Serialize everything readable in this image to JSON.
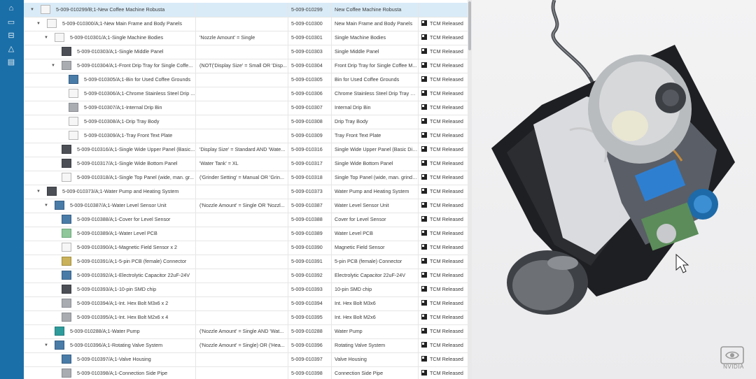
{
  "sidebar": {
    "icons": [
      "home-icon",
      "folder-icon",
      "inbox-icon",
      "warning-icon",
      "document-icon"
    ]
  },
  "rows": [
    {
      "name": "5-009-010299/B;1-New Coffee Machine Robusta",
      "effectivity": "",
      "part_number": "5-009-010299",
      "title": "New Coffee Machine Robusta",
      "status": ""
    },
    {
      "name": "5-009-010300/A;1-New Main Frame and Body Panels",
      "effectivity": "",
      "part_number": "5-009-010300",
      "title": "New Main Frame and Body Panels",
      "status": "TCM Released"
    },
    {
      "name": "5-009-010301/A;1-Single Machine Bodies",
      "effectivity": "'Nozzle Amount' = Single",
      "part_number": "5-009-010301",
      "title": "Single Machine Bodies",
      "status": "TCM Released"
    },
    {
      "name": "5-009-010303/A;1-Single Middle Panel",
      "effectivity": "",
      "part_number": "5-009-010303",
      "title": "Single Middle Panel",
      "status": "TCM Released"
    },
    {
      "name": "5-009-010304/A;1-Front Drip Tray for Single Coffe...",
      "effectivity": "(NOT('Display Size' = Small OR 'Disp...",
      "part_number": "5-009-010304",
      "title": "Front Drip Tray for Single Coffee M...",
      "status": "TCM Released"
    },
    {
      "name": "5-009-010305/A;1-Bin for Used Coffee Grounds",
      "effectivity": "",
      "part_number": "5-009-010305",
      "title": "Bin for Used Coffee Grounds",
      "status": "TCM Released"
    },
    {
      "name": "5-009-010306/A;1-Chrome Stainless Steel Drip ...",
      "effectivity": "",
      "part_number": "5-009-010306",
      "title": "Chrome Stainless Steel Drip Tray Pl...",
      "status": "TCM Released"
    },
    {
      "name": "5-009-010307/A;1-Internal Drip Bin",
      "effectivity": "",
      "part_number": "5-009-010307",
      "title": "Internal Drip Bin",
      "status": "TCM Released"
    },
    {
      "name": "5-009-010308/A;1-Drip Tray Body",
      "effectivity": "",
      "part_number": "5-009-010308",
      "title": "Drip Tray Body",
      "status": "TCM Released"
    },
    {
      "name": "5-009-010309/A;1-Tray Front Text Plate",
      "effectivity": "",
      "part_number": "5-009-010309",
      "title": "Tray Front Text Plate",
      "status": "TCM Released"
    },
    {
      "name": "5-009-010316/A;1-Single Wide Upper Panel (Basic...",
      "effectivity": "'Display Size' = Standard AND 'Wate...",
      "part_number": "5-009-010316",
      "title": "Single Wide Upper Panel (Basic Dis...",
      "status": "TCM Released"
    },
    {
      "name": "5-009-010317/A;1-Single Wide Bottom Panel",
      "effectivity": "'Water Tank' = XL",
      "part_number": "5-009-010317",
      "title": "Single Wide Bottom Panel",
      "status": "TCM Released"
    },
    {
      "name": "5-009-010318/A;1-Single Top Panel (wide, man. gr...",
      "effectivity": "('Grinder Setting' = Manual OR 'Grin...",
      "part_number": "5-009-010318",
      "title": "Single Top Panel (wide, man. grinder)",
      "status": "TCM Released"
    },
    {
      "name": "5-009-010373/A;1-Water Pump and Heating System",
      "effectivity": "",
      "part_number": "5-009-010373",
      "title": "Water Pump and Heating System",
      "status": "TCM Released"
    },
    {
      "name": "5-009-010387/A;1-Water Level Sensor Unit",
      "effectivity": "('Nozzle Amount' = Single OR 'Nozzl...",
      "part_number": "5-009-010387",
      "title": "Water Level Sensor Unit",
      "status": "TCM Released"
    },
    {
      "name": "5-009-010388/A;1-Cover for Level Sensor",
      "effectivity": "",
      "part_number": "5-009-010388",
      "title": "Cover for Level Sensor",
      "status": "TCM Released"
    },
    {
      "name": "5-009-010389/A;1-Water Level PCB",
      "effectivity": "",
      "part_number": "5-009-010389",
      "title": "Water Level PCB",
      "status": "TCM Released"
    },
    {
      "name": "5-009-010390/A;1-Magnetic Field Sensor x 2",
      "effectivity": "",
      "part_number": "5-009-010390",
      "title": "Magnetic Field Sensor",
      "status": "TCM Released"
    },
    {
      "name": "5-009-010391/A;1-5-pin PCB (female) Connector",
      "effectivity": "",
      "part_number": "5-009-010391",
      "title": "5-pin PCB (female) Connector",
      "status": "TCM Released"
    },
    {
      "name": "5-009-010392/A;1-Electrolytic Capacitor 22uF-24V",
      "effectivity": "",
      "part_number": "5-009-010392",
      "title": "Electrolytic Capacitor 22uF-24V",
      "status": "TCM Released"
    },
    {
      "name": "5-009-010393/A;1-10-pin SMD chip",
      "effectivity": "",
      "part_number": "5-009-010393",
      "title": "10-pin SMD chip",
      "status": "TCM Released"
    },
    {
      "name": "5-009-010394/A;1-Int. Hex Bolt M3x6 x 2",
      "effectivity": "",
      "part_number": "5-009-010394",
      "title": "Int. Hex Bolt M3x6",
      "status": "TCM Released"
    },
    {
      "name": "5-009-010395/A;1-Int. Hex Bolt M2x6 x 4",
      "effectivity": "",
      "part_number": "5-009-010395",
      "title": "Int. Hex Bolt M2x6",
      "status": "TCM Released"
    },
    {
      "name": "5-009-010288/A;1-Water Pump",
      "effectivity": "('Nozzle Amount' = Single AND 'Wat...",
      "part_number": "5-009-010288",
      "title": "Water Pump",
      "status": "TCM Released"
    },
    {
      "name": "5-009-010396/A;1-Rotating Valve System",
      "effectivity": "('Nozzle Amount' = Single) OR ('Hea...",
      "part_number": "5-009-010396",
      "title": "Rotating Valve System",
      "status": "TCM Released"
    },
    {
      "name": "5-009-010397/A;1-Valve Housing",
      "effectivity": "",
      "part_number": "5-009-010397",
      "title": "Valve Housing",
      "status": "TCM Released"
    },
    {
      "name": "5-009-010398/A;1-Connection Side Pipe",
      "effectivity": "",
      "part_number": "5-009-010398",
      "title": "Connection Side Pipe",
      "status": "TCM Released"
    }
  ],
  "branding": {
    "name": "NVIDIA"
  }
}
